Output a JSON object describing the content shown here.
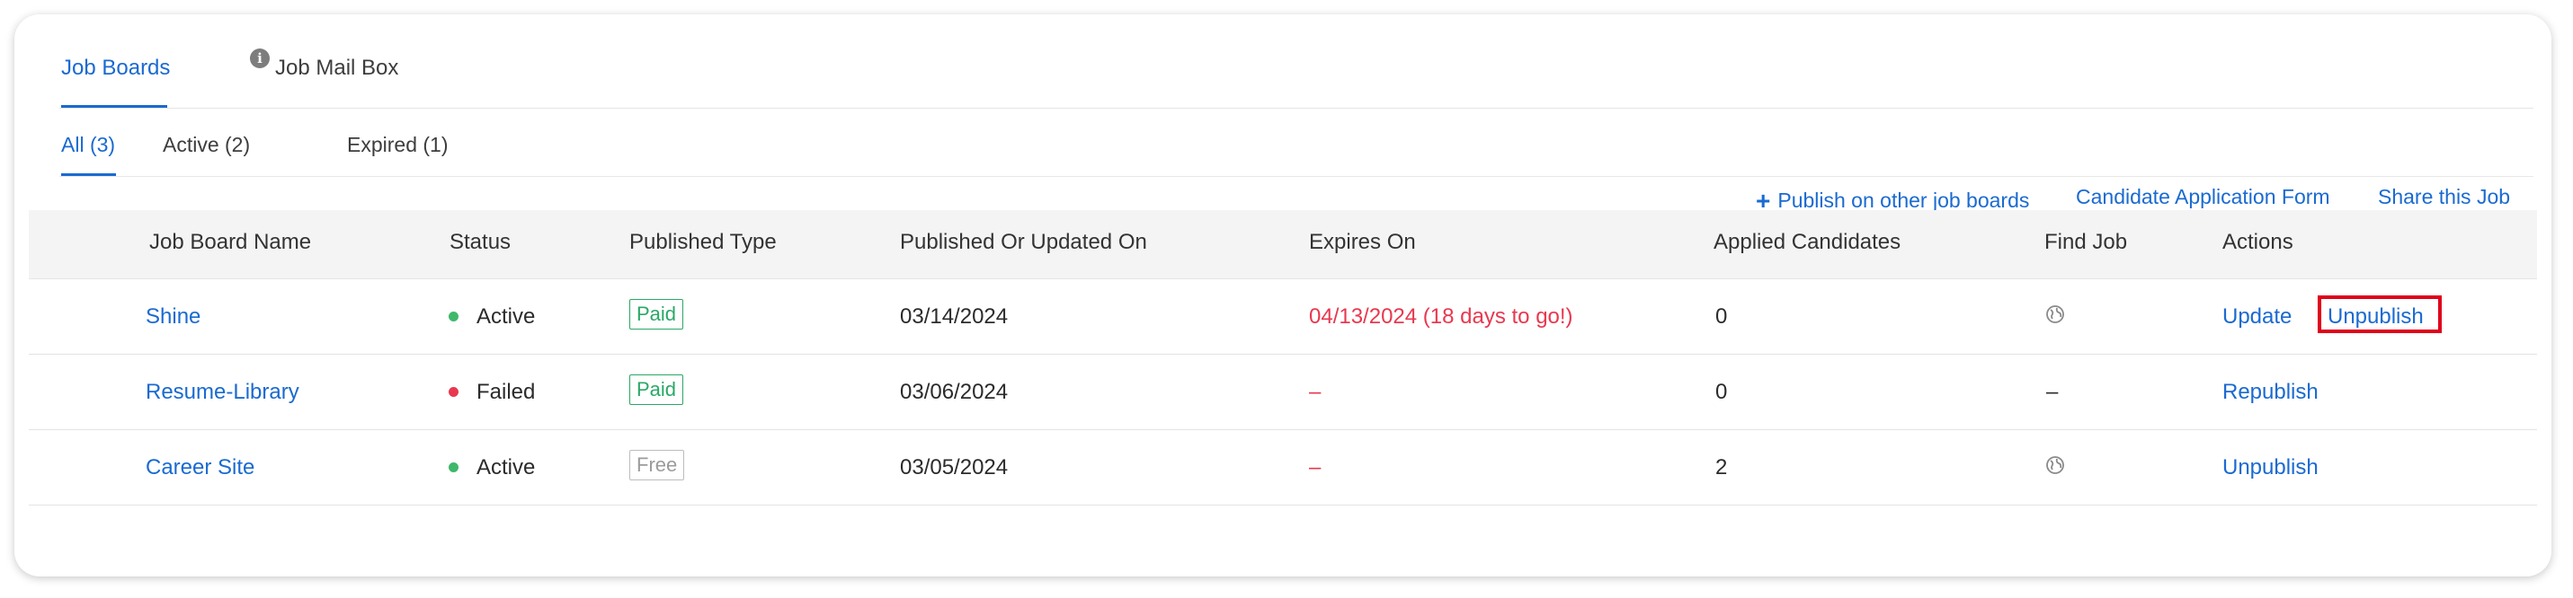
{
  "tabs": {
    "job_boards": "Job Boards",
    "job_mail_box": "Job Mail Box",
    "info_icon_glyph": "i"
  },
  "sub_tabs": {
    "all": "All (3)",
    "active": "Active (2)",
    "expired": "Expired (1)"
  },
  "links": {
    "plus": "+",
    "publish_other": "Publish on other job boards",
    "application_form": "Candidate Application Form",
    "share_job": "Share this Job"
  },
  "table": {
    "headers": {
      "name": "Job Board Name",
      "status": "Status",
      "published_type": "Published Type",
      "published_on": "Published Or Updated On",
      "expires_on": "Expires On",
      "applied": "Applied Candidates",
      "find_job": "Find Job",
      "actions": "Actions"
    },
    "rows": [
      {
        "name": "Shine",
        "status": "Active",
        "type": "Paid",
        "published_on": "03/14/2024",
        "expires_on": "04/13/2024 (18 days to go!)",
        "applied": "0",
        "find_job": "globe-icon",
        "actions": [
          "Update",
          "Unpublish"
        ]
      },
      {
        "name": "Resume-Library",
        "status": "Failed",
        "type": "Paid",
        "published_on": "03/06/2024",
        "expires_on": "–",
        "applied": "0",
        "find_job": "–",
        "actions": [
          "Republish"
        ]
      },
      {
        "name": "Career Site",
        "status": "Active",
        "type": "Free",
        "published_on": "03/05/2024",
        "expires_on": "–",
        "applied": "2",
        "find_job": "globe-icon",
        "actions": [
          "Unpublish"
        ]
      }
    ]
  },
  "colors": {
    "accent": "#1a6ad1",
    "active_dot": "#3fb86a",
    "failed_dot": "#e8384f",
    "expiry_red": "#e8384f",
    "paid_green": "#2aa866",
    "highlight_red": "#e0001b"
  }
}
